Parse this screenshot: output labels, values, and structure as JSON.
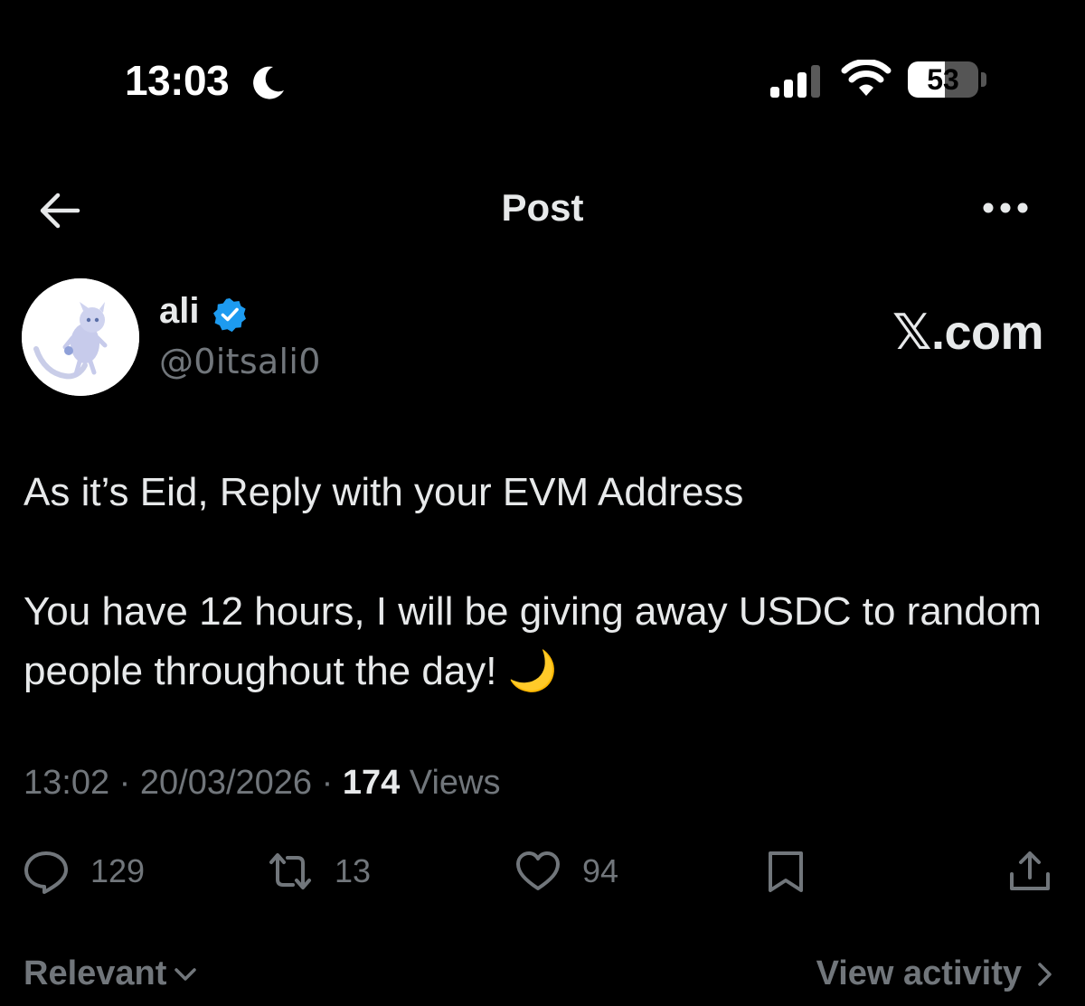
{
  "status_bar": {
    "time": "13:03",
    "focus_icon": "moon-icon",
    "signal_icon": "cellular-signal-icon",
    "wifi_icon": "wifi-icon",
    "battery_level": 53,
    "battery_text": "53"
  },
  "header": {
    "title": "Post",
    "back_icon": "back-arrow-icon",
    "more_icon": "more-horizontal-icon"
  },
  "author": {
    "display_name": "ali",
    "handle": "@0itsali0",
    "verified": true,
    "verified_color": "#1d9bf0"
  },
  "watermark": "𝕏.com",
  "post": {
    "paragraph_1": "As it’s Eid, Reply with your EVM Address",
    "paragraph_2": "You have 12 hours, I will be giving away USDC to random people throughout the day! 🌙"
  },
  "meta": {
    "time": "13:02",
    "separator": " · ",
    "date": "20/03/2026",
    "views_count": "174",
    "views_label": " Views"
  },
  "actions": {
    "replies": "129",
    "reposts": "13",
    "likes": "94"
  },
  "footer": {
    "sort_label": "Relevant",
    "activity_label": "View activity"
  },
  "colors": {
    "background": "#000000",
    "text_primary": "#e7e9ea",
    "text_secondary": "#71767b",
    "accent": "#1d9bf0"
  }
}
